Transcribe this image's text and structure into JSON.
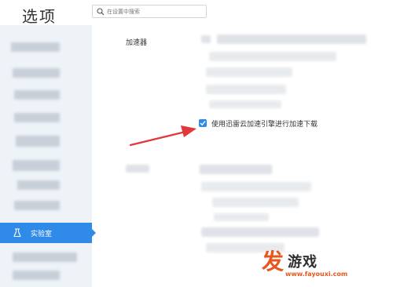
{
  "window": {
    "title": "选项"
  },
  "search": {
    "placeholder": "在设置中搜索"
  },
  "sidebar": {
    "selected_item": {
      "label": "实验室",
      "icon": "flask-icon"
    }
  },
  "main": {
    "section_label": "加速器",
    "checkbox": {
      "label": "使用迅雷云加速引擎进行加速下载",
      "checked": true
    }
  },
  "watermark": {
    "logo": "发",
    "brand": "游戏",
    "url": "www.fayouxi.com"
  },
  "colors": {
    "accent": "#2f8be7",
    "arrow": "#e0383b",
    "sidebar_bg": "#eef3f8",
    "watermark": "#e8561d"
  }
}
